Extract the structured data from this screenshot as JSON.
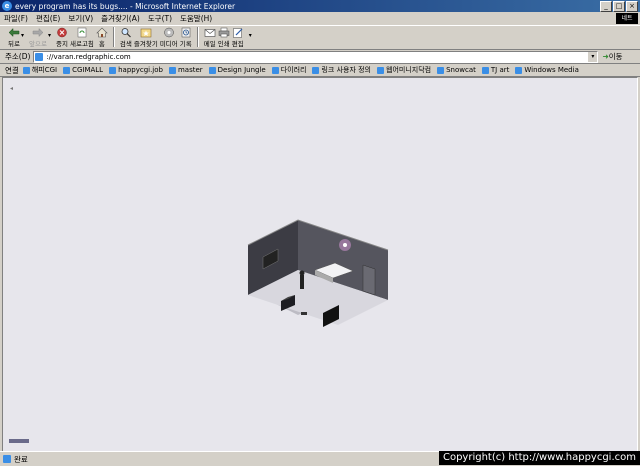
{
  "window": {
    "title": "every program has its bugs.... - Microsoft Internet Explorer",
    "brand_box": "네트"
  },
  "menu": [
    "파일(F)",
    "편집(E)",
    "보기(V)",
    "즐겨찾기(A)",
    "도구(T)",
    "도움말(H)"
  ],
  "toolbar": {
    "back": "뒤로",
    "forward": "앞으로",
    "stop": "중지",
    "refresh": "새로고침",
    "home": "홈",
    "search": "검색",
    "favorites": "즐겨찾기",
    "media": "미디어",
    "history": "기록",
    "mail": "메일",
    "print": "인쇄",
    "edit": "편집"
  },
  "address": {
    "label": "주소(D)",
    "value": "://varan.redgraphic.com",
    "go": "이동"
  },
  "links": {
    "label": "연결",
    "items": [
      "해피CGI",
      "CGIMALL",
      "happycgi.job",
      "master",
      "Design Jungle",
      "다이러리",
      "링크 사용자 정의",
      "웹어미니지닥컴",
      "Snowcat",
      "TJ art",
      "Windows Media"
    ]
  },
  "status": {
    "text": "완료",
    "copyright": "Copyright(c) http://www.happycgi.com"
  },
  "colors": {
    "titlebar_start": "#0a246a",
    "titlebar_end": "#3a6ea5",
    "chrome": "#d4d0c8",
    "content_bg": "#e7e6ec"
  }
}
